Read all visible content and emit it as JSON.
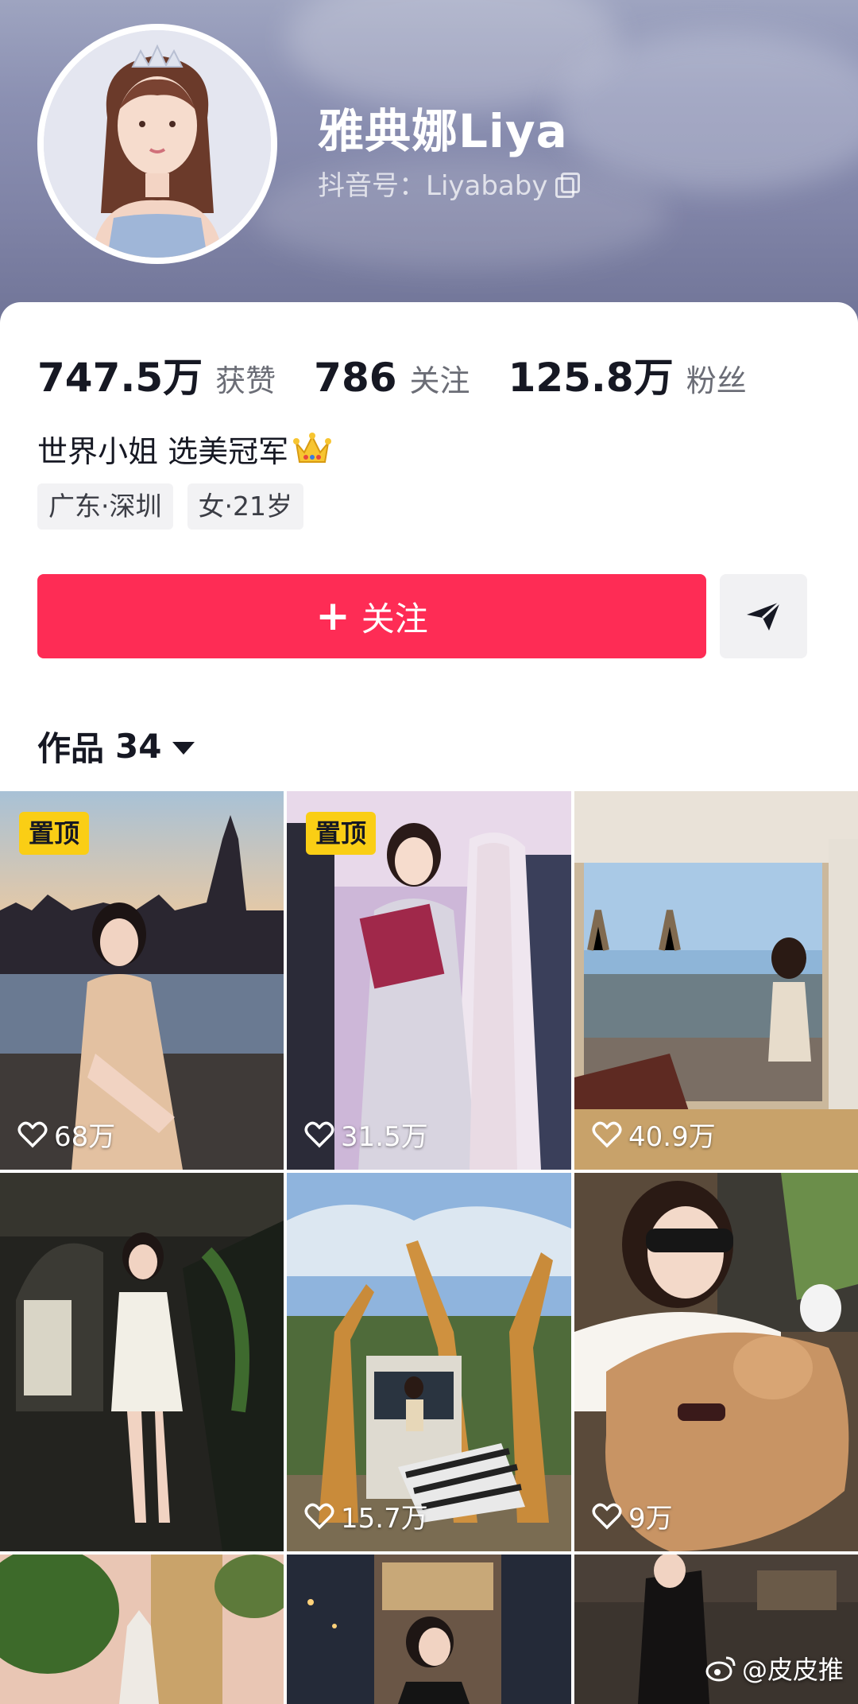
{
  "profile": {
    "name": "雅典娜Liya",
    "douyin_id": "抖音号：Liyababy",
    "bio": "世界小姐 选美冠军",
    "bio_emoji": "crown-icon",
    "tags": [
      "广东·深圳",
      "女·21岁"
    ]
  },
  "stats": [
    {
      "value": "747.5万",
      "label": "获赞"
    },
    {
      "value": "786",
      "label": "关注"
    },
    {
      "value": "125.8万",
      "label": "粉丝"
    }
  ],
  "actions": {
    "follow_label": "关注",
    "share_icon": "send-icon"
  },
  "works": {
    "label": "作品",
    "count": "34"
  },
  "videos": [
    {
      "likes": "68万",
      "pinned": "置顶",
      "scene": "london-sunset"
    },
    {
      "likes": "31.5万",
      "pinned": "置顶",
      "scene": "pageant-stage"
    },
    {
      "likes": "40.9万",
      "scene": "tower-bridge-window"
    },
    {
      "likes": "",
      "scene": "dark-staircase"
    },
    {
      "likes": "15.7万",
      "scene": "giraffes-safari"
    },
    {
      "likes": "9万",
      "scene": "lion-cub"
    },
    {
      "likes": "",
      "scene": "palm-towers"
    },
    {
      "likes": "",
      "scene": "city-night"
    },
    {
      "likes": "",
      "scene": "street-night"
    }
  ],
  "watermark": "@皮皮推",
  "colors": {
    "accent": "#fe2c55",
    "pin_badge": "#face15",
    "text_primary": "#161823",
    "text_secondary": "#6b6d76"
  }
}
